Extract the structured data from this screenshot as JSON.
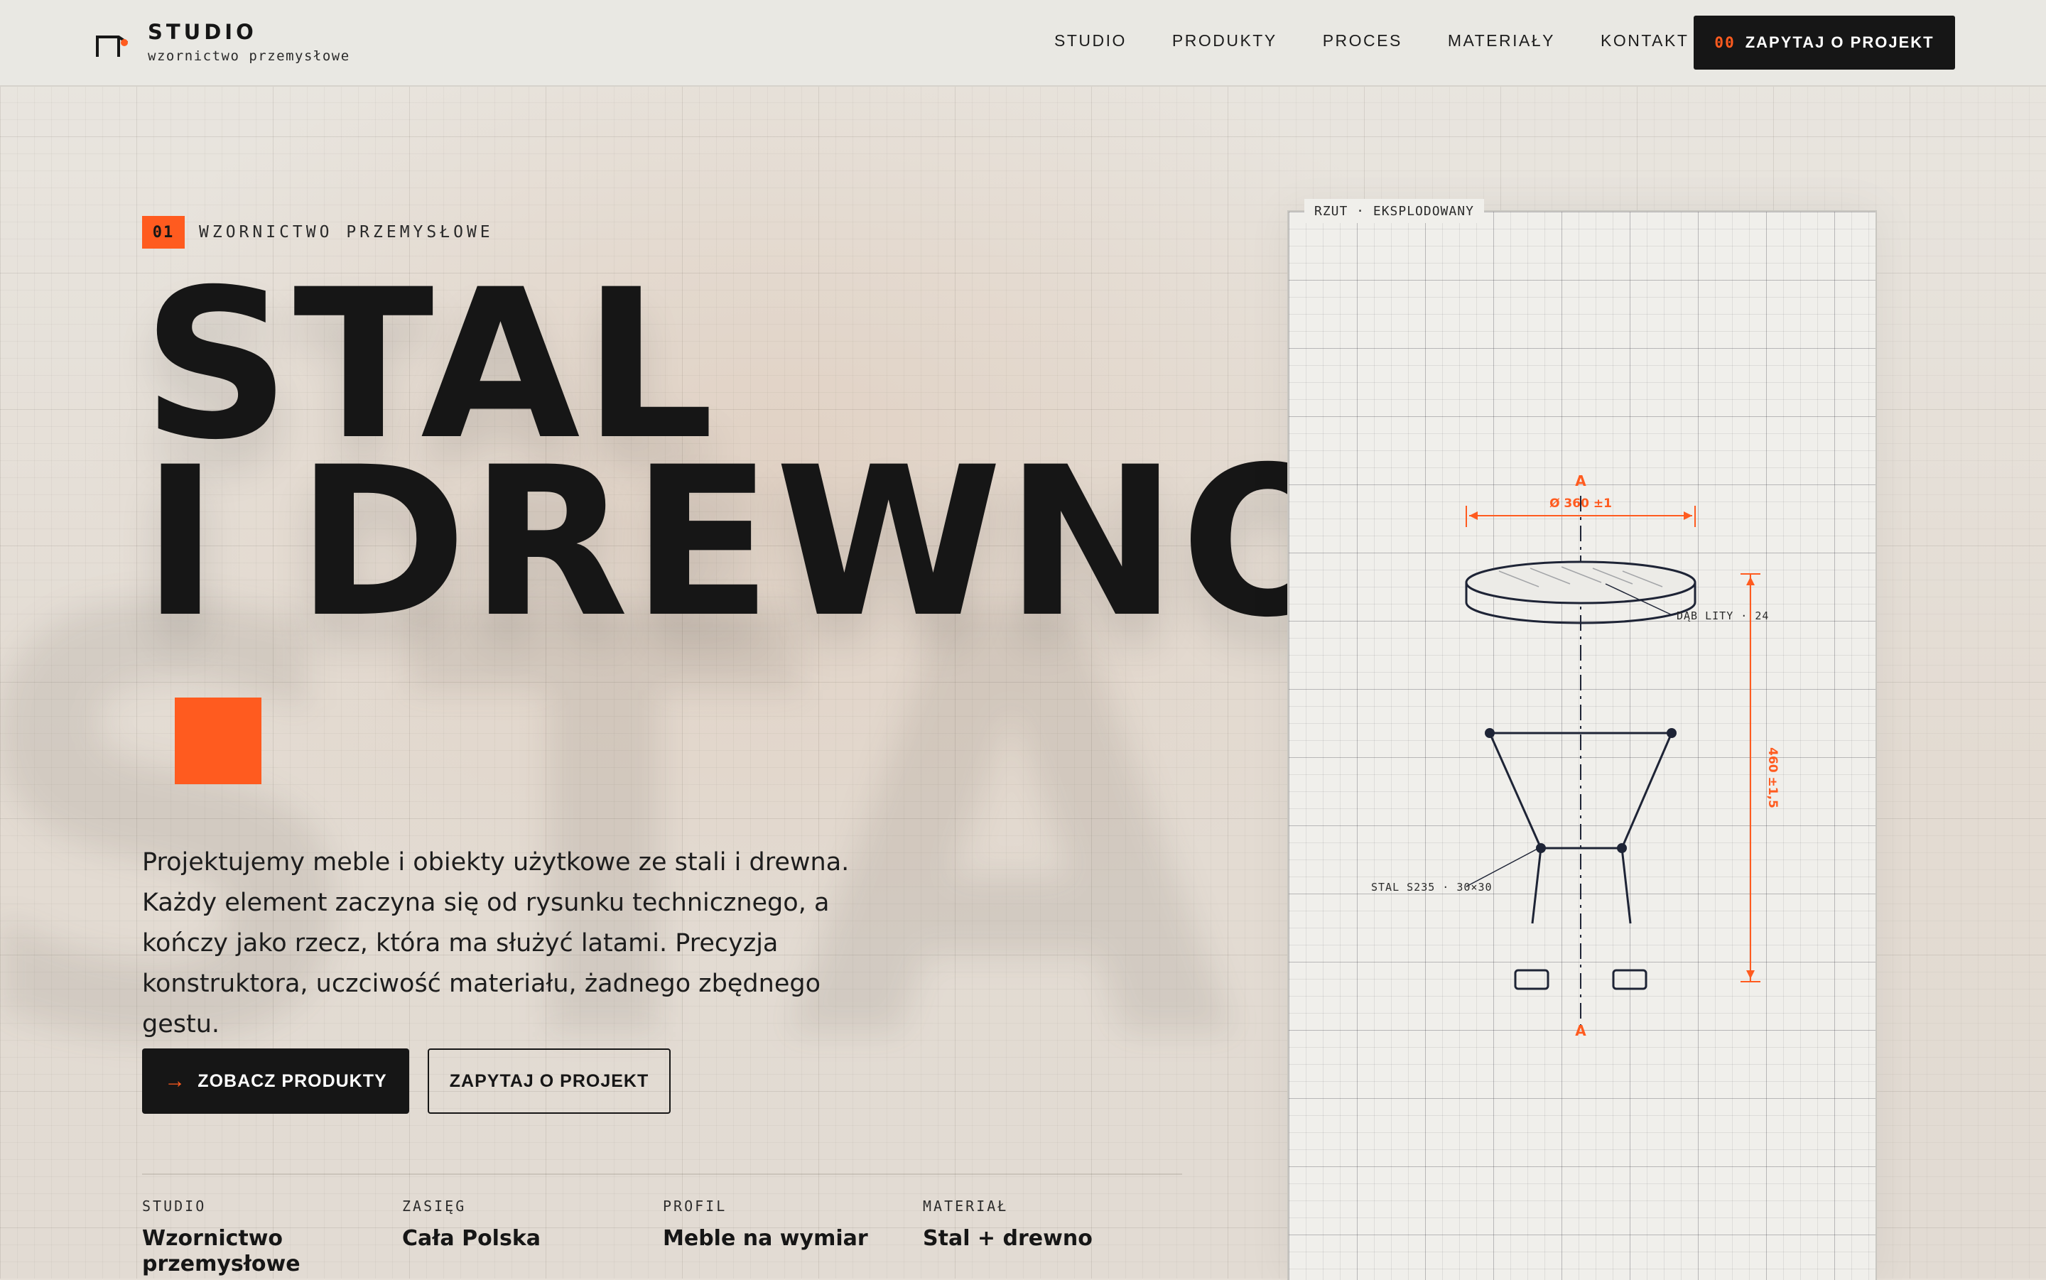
{
  "header": {
    "brand": "STUDIO",
    "tagline": "wzornictwo przemysłowe",
    "nav": [
      "STUDIO",
      "PRODUKTY",
      "PROCES",
      "MATERIAŁY",
      "KONTAKT"
    ],
    "cta_number": "00",
    "cta_label": "ZAPYTAJ O PROJEKT"
  },
  "hero": {
    "eyebrow_number": "01",
    "eyebrow_text": "WZORNICTWO PRZEMYSŁOWE",
    "headline_line1": "STAL",
    "headline_line2": "I DREWNO",
    "lead": "Projektujemy meble i obiekty użytkowe ze stali i drewna. Każdy element zaczyna się od rysunku technicznego, a kończy jako rzecz, która ma służyć latami. Precyzja konstruktora, uczciwość materiału, żadnego zbędnego gestu.",
    "primary_button": "ZOBACZ PRODUKTY",
    "primary_button_arrow": "→",
    "secondary_button": "ZAPYTAJ O PROJEKT"
  },
  "stats": [
    {
      "label": "STUDIO",
      "value": "Wzornictwo przemysłowe"
    },
    {
      "label": "ZASIĘG",
      "value": "Cała Polska"
    },
    {
      "label": "PROFIL",
      "value": "Meble na wymiar"
    },
    {
      "label": "MATERIAŁ",
      "value": "Stal + drewno"
    }
  ],
  "drawing": {
    "tag": "RZUT · EKSPLODOWANY",
    "section_marker": "A",
    "diameter_dim": "Ø 360 ±1",
    "height_dim": "460 ±1,5",
    "top_callout": "DĄB LITY · 24",
    "frame_callout": "STAL S235 · 30×30"
  },
  "background_word": "STAL",
  "colors": {
    "accent": "#ff5b1f",
    "ink": "#161616",
    "drawing_line": "#1e2436"
  }
}
